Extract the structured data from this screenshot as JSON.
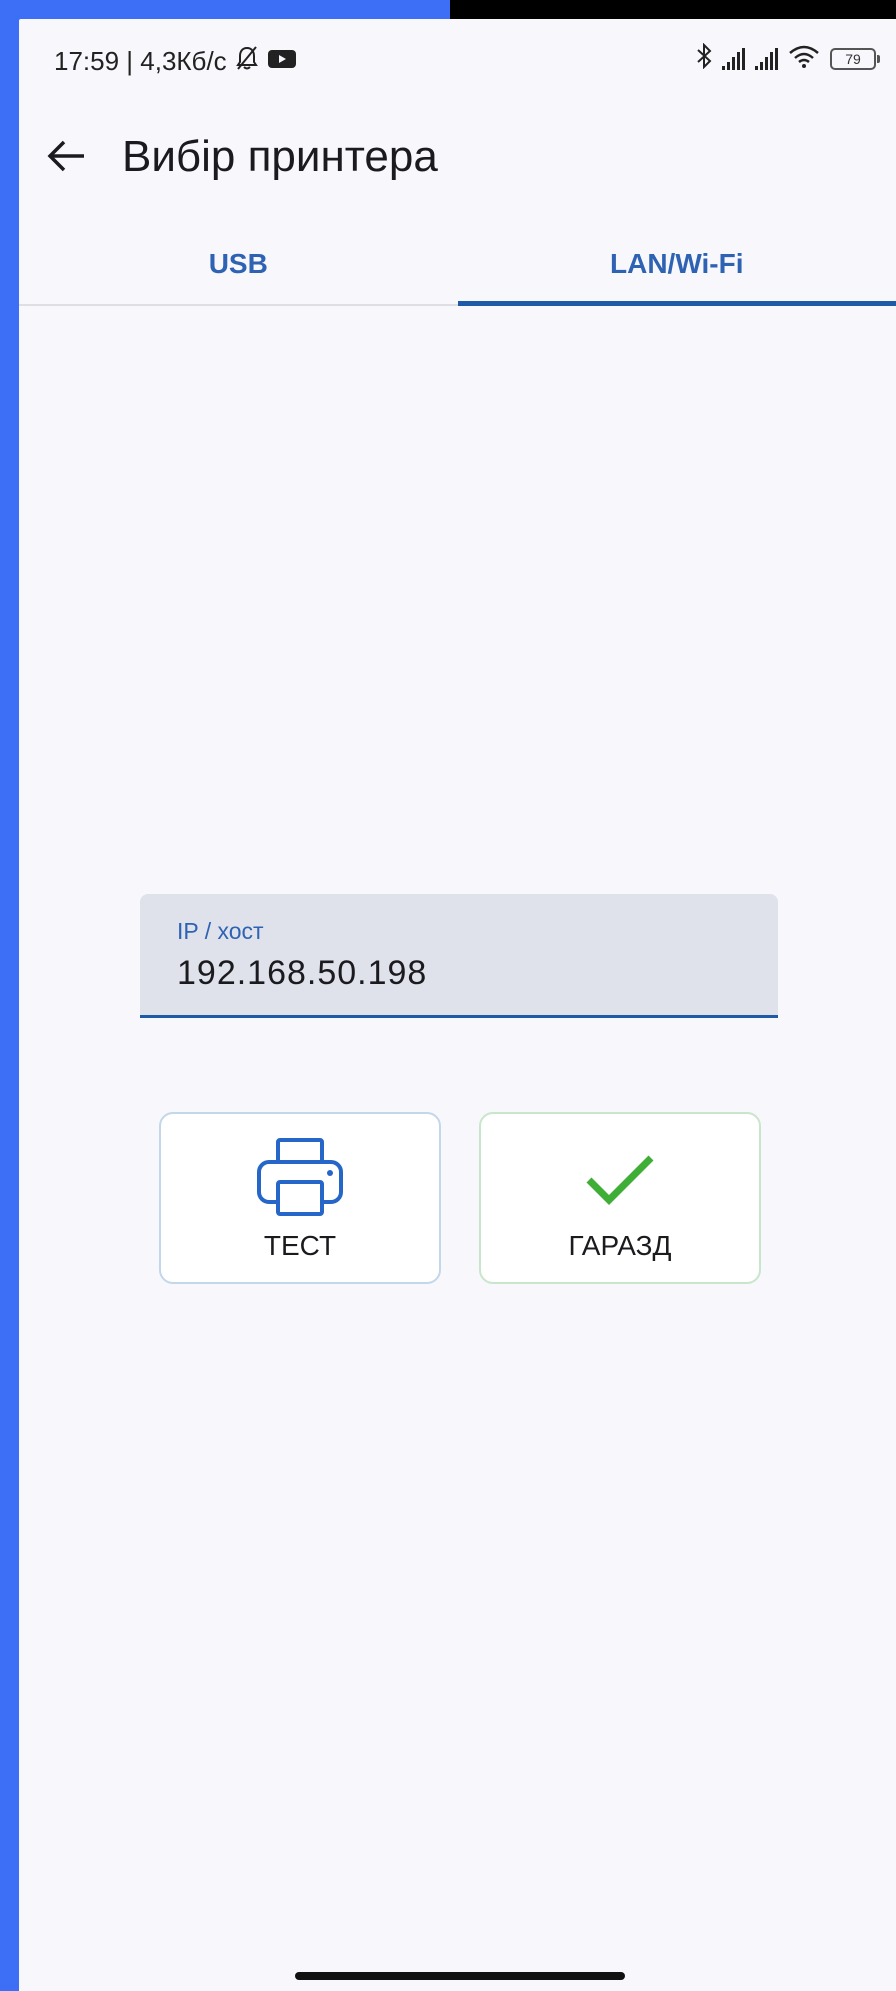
{
  "status_bar": {
    "time_speed": "17:59 | 4,3Кб/с",
    "battery": "79",
    "icons": [
      "bell-off-icon",
      "video-icon",
      "bluetooth-icon",
      "signal-icon",
      "signal-icon",
      "wifi-icon",
      "battery-icon"
    ]
  },
  "app_bar": {
    "title": "Вибір принтера",
    "back_icon": "arrow-left-icon"
  },
  "tabs": [
    {
      "label": "USB",
      "active": false
    },
    {
      "label": "LAN/Wi-Fi",
      "active": true
    }
  ],
  "ip_field": {
    "label": "IP / хост",
    "value": "192.168.50.198"
  },
  "buttons": {
    "test": {
      "label": "ТЕСТ",
      "icon": "printer-icon"
    },
    "ok": {
      "label": "ГАРАЗД",
      "icon": "checkmark-icon"
    }
  },
  "colors": {
    "accent": "#1d5ba8",
    "tab_text": "#2e63b3",
    "check": "#3fae36",
    "frame_blue": "#3d6ef6"
  }
}
